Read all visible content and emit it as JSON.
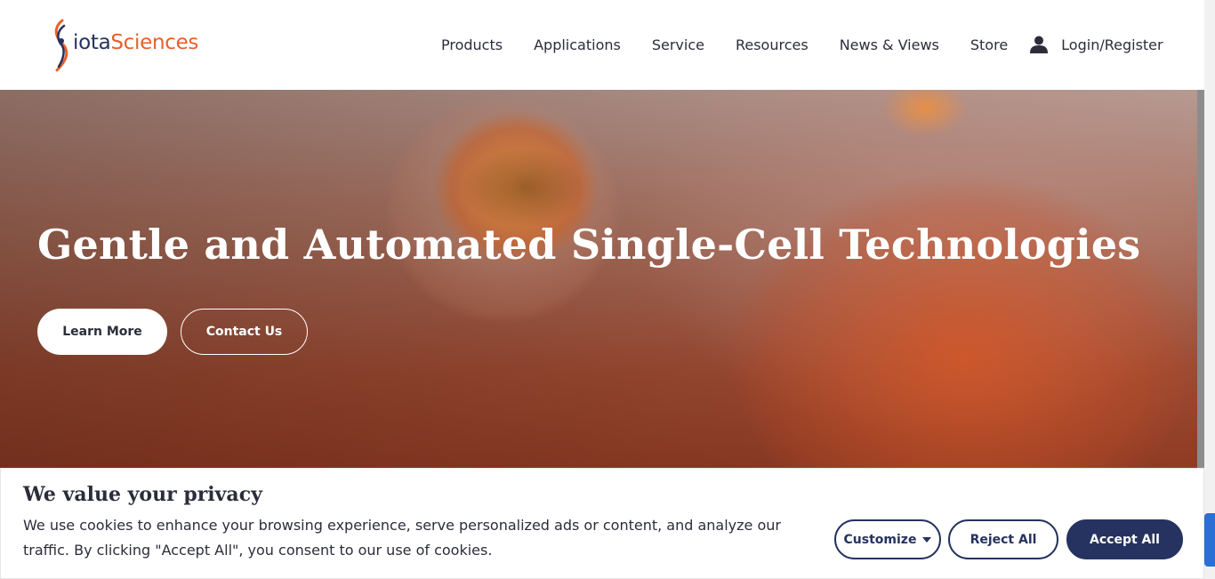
{
  "header": {
    "logo": {
      "part1": "iota",
      "part2": "Sciences",
      "icon": "dna-helix-icon"
    },
    "nav": [
      "Products",
      "Applications",
      "Service",
      "Resources",
      "News & Views",
      "Store"
    ],
    "user_icon": "user-icon",
    "login_label": "Login/Register"
  },
  "hero": {
    "title": "Gentle and Automated Single-Cell Technologies",
    "learn_more": "Learn More",
    "contact_us": "Contact Us"
  },
  "cookie_banner": {
    "title": "We value your privacy",
    "text": "We use cookies to enhance your browsing experience, serve personalized ads or content, and analyze our traffic. By clicking \"Accept All\", you consent to our use of cookies.",
    "customize_label": "Customize",
    "reject_label": "Reject All",
    "accept_label": "Accept All"
  },
  "colors": {
    "brand_navy": "#26325f",
    "brand_orange": "#e8602c"
  }
}
